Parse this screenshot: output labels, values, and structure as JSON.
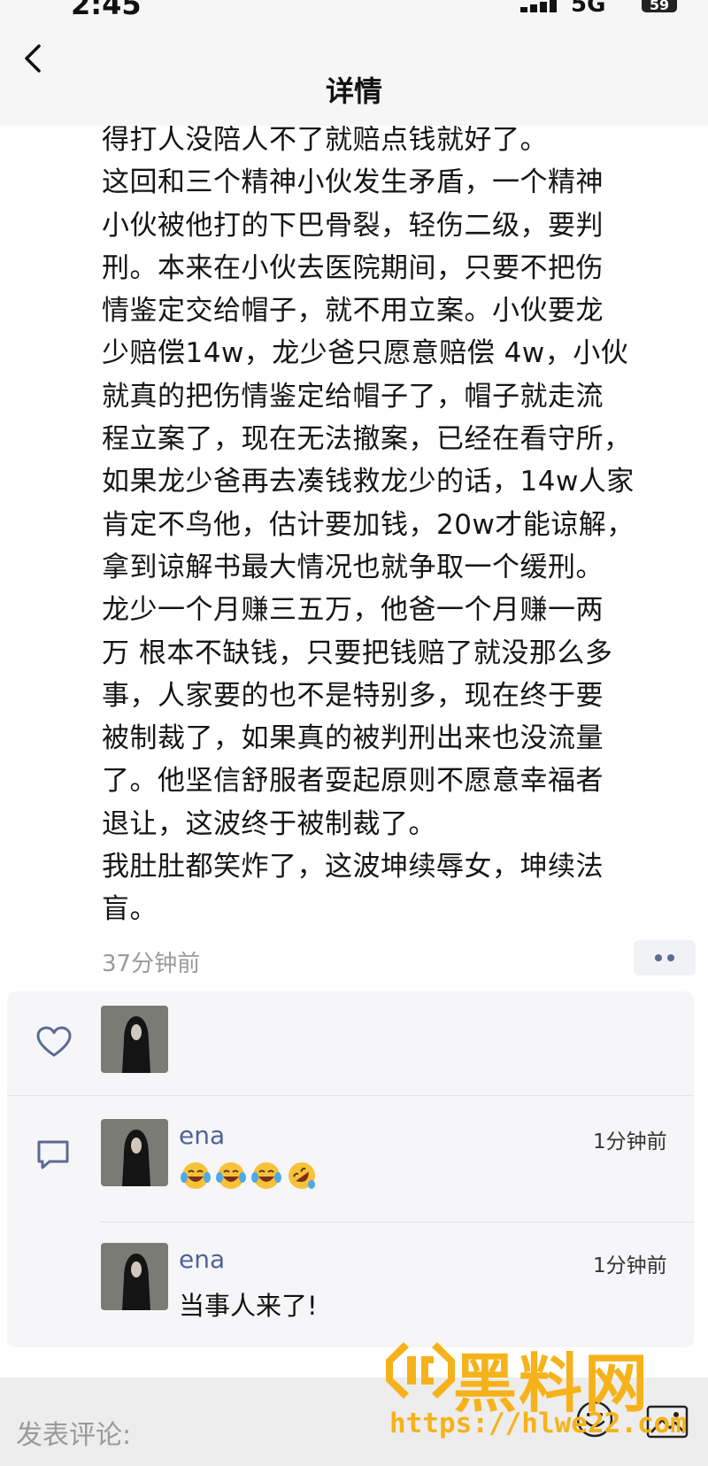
{
  "status_bar": {
    "time": "2:45",
    "network": "5G",
    "battery": "59"
  },
  "nav": {
    "title": "详情"
  },
  "post": {
    "lines": [
      "得打人没陪人不了就赔点钱就好了。",
      "这回和三个精神小伙发生矛盾，一个精神",
      "小伙被他打的下巴骨裂，轻伤二级，要判",
      "刑。本来在小伙去医院期间，只要不把伤",
      "情鉴定交给帽子，就不用立案。小伙要龙",
      "少赔偿14w，龙少爸只愿意赔偿 4w，小伙",
      "就真的把伤情鉴定给帽子了，帽子就走流",
      "程立案了，现在无法撤案，已经在看守所，",
      "如果龙少爸再去凑钱救龙少的话，14w人家",
      "肯定不鸟他，估计要加钱，20w才能谅解，",
      "拿到谅解书最大情况也就争取一个缓刑。",
      "龙少一个月赚三五万，他爸一个月赚一两",
      "万 根本不缺钱，只要把钱赔了就没那么多",
      "事，人家要的也不是特别多，现在终于要",
      "被制裁了，如果真的被判刑出来也没流量",
      "了。他坚信舒服者耍起原则不愿意幸福者",
      "退让，这波终于被制裁了。",
      "我肚肚都笑炸了，这波坤续辱女，坤续法",
      "盲。"
    ],
    "timestamp": "37分钟前"
  },
  "comments": [
    {
      "name": "ena",
      "time": "1分钟前",
      "emoji_count": 4
    },
    {
      "name": "ena",
      "time": "1分钟前",
      "text": "当事人来了!"
    }
  ],
  "input": {
    "placeholder": "发表评论:"
  },
  "watermark": {
    "title": "黑料网",
    "url": "https://hlwe22.com"
  },
  "colors": {
    "accent": "#4f6396",
    "watermark": "#f6b21a"
  }
}
